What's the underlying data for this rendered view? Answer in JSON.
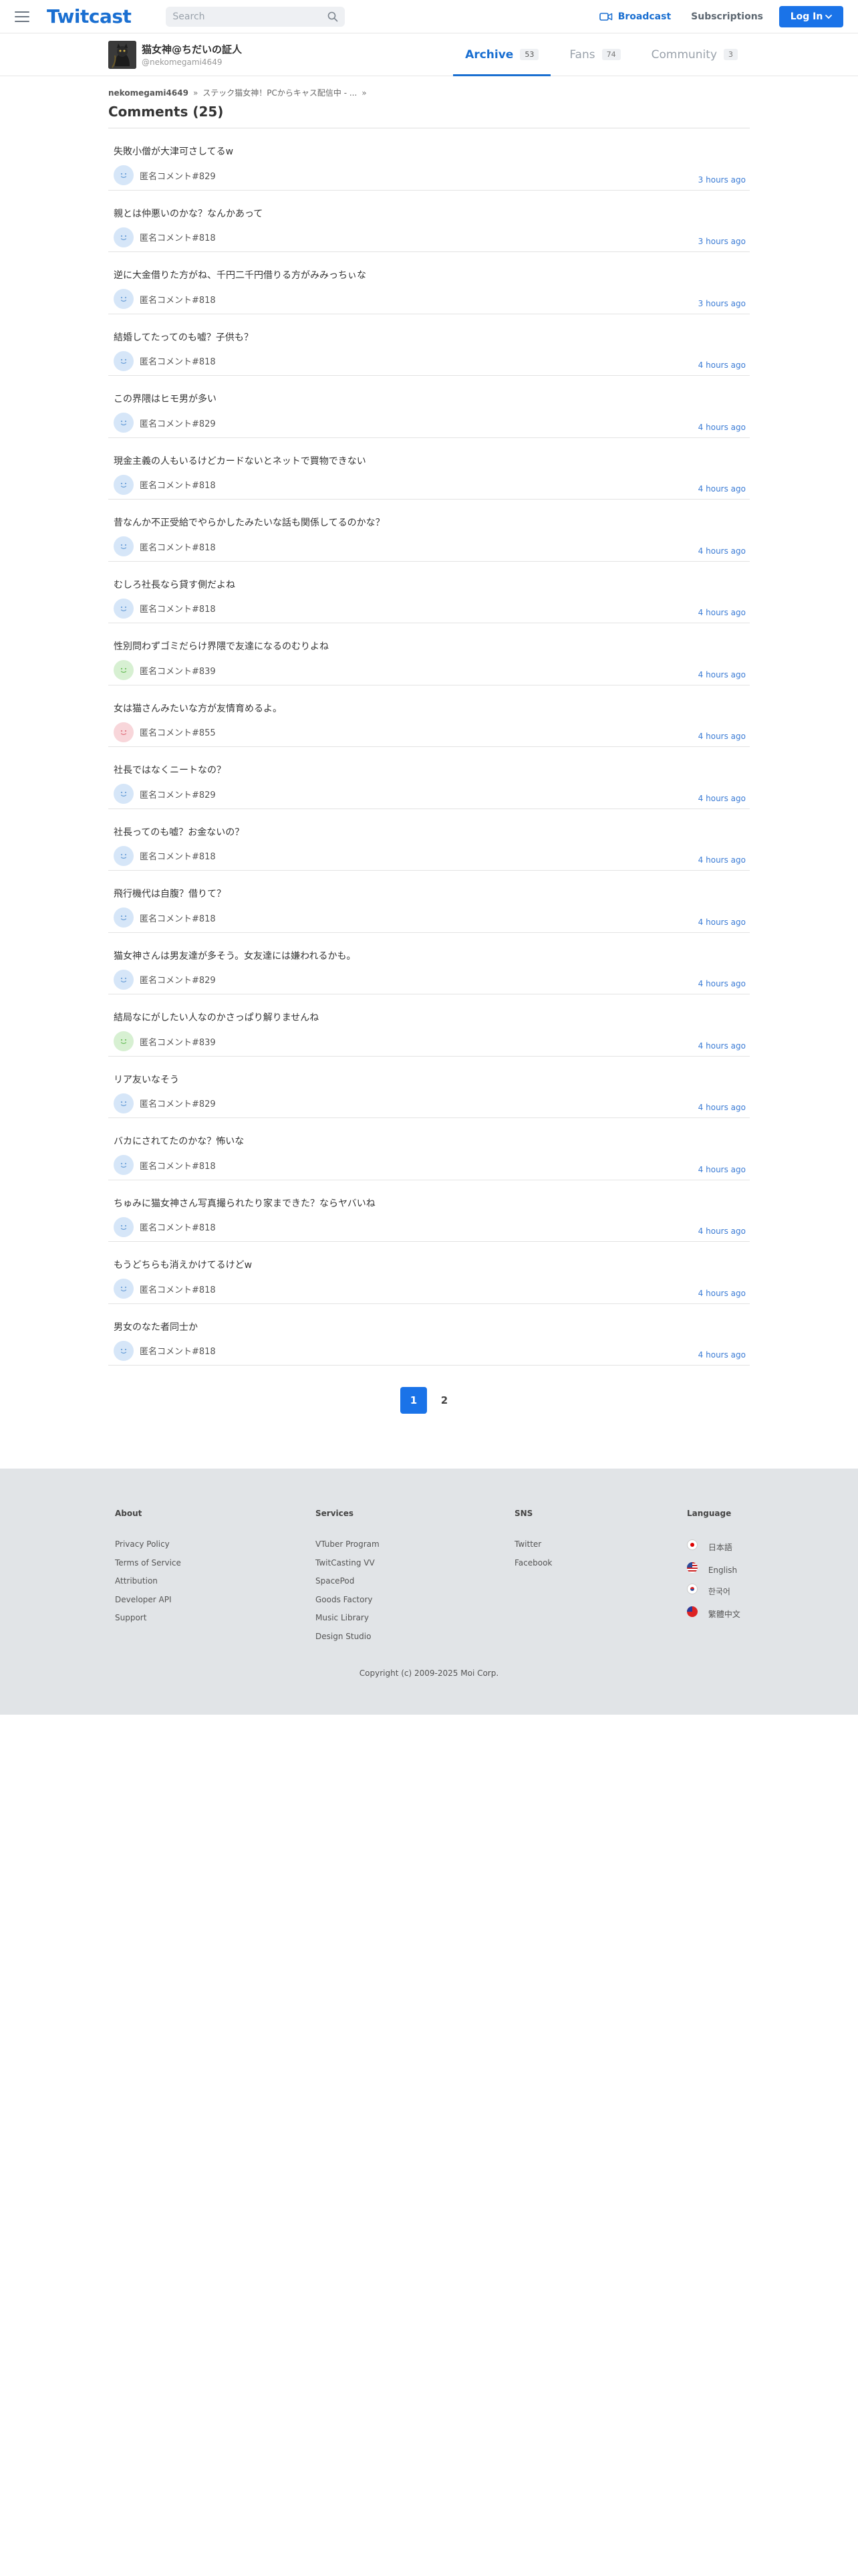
{
  "header": {
    "logo": "Twitcast",
    "search_placeholder": "Search",
    "broadcast": "Broadcast",
    "subscriptions": "Subscriptions",
    "login": "Log In"
  },
  "profile": {
    "name": "猫女神@ちだいの証人",
    "id": "@nekomegami4649"
  },
  "tabs": [
    {
      "label": "Archive",
      "count": "53"
    },
    {
      "label": "Fans",
      "count": "74"
    },
    {
      "label": "Community",
      "count": "3"
    }
  ],
  "breadcrumb": [
    "nekomegami4649",
    "ステック猫女神！PCからキャス配信中 - ...",
    ""
  ],
  "page_title": "Comments (25)",
  "comments": [
    {
      "text": "失敗小僧が大津可さしてるw",
      "name": "匿名コメント#829",
      "time": "3 hours ago",
      "avatar_color": "#d6e6f8",
      "face_color": "#6a9fd8"
    },
    {
      "text": "親とは仲悪いのかな？なんかあって",
      "name": "匿名コメント#818",
      "time": "3 hours ago",
      "avatar_color": "#d6e6f8",
      "face_color": "#6a9fd8"
    },
    {
      "text": "逆に大金借りた方がね、千円二千円借りる方がみみっちぃな",
      "name": "匿名コメント#818",
      "time": "3 hours ago",
      "avatar_color": "#d6e6f8",
      "face_color": "#6a9fd8"
    },
    {
      "text": "結婚してたってのも嘘？子供も？",
      "name": "匿名コメント#818",
      "time": "4 hours ago",
      "avatar_color": "#d6e6f8",
      "face_color": "#6a9fd8"
    },
    {
      "text": "この界隈はヒモ男が多い",
      "name": "匿名コメント#829",
      "time": "4 hours ago",
      "avatar_color": "#d6e6f8",
      "face_color": "#6a9fd8"
    },
    {
      "text": "現金主義の人もいるけどカードないとネットで買物できない",
      "name": "匿名コメント#818",
      "time": "4 hours ago",
      "avatar_color": "#d6e6f8",
      "face_color": "#6a9fd8"
    },
    {
      "text": "昔なんか不正受給でやらかしたみたいな話も関係してるのかな？",
      "name": "匿名コメント#818",
      "time": "4 hours ago",
      "avatar_color": "#d6e6f8",
      "face_color": "#6a9fd8"
    },
    {
      "text": "むしろ社長なら貸す側だよね",
      "name": "匿名コメント#818",
      "time": "4 hours ago",
      "avatar_color": "#d6e6f8",
      "face_color": "#6a9fd8"
    },
    {
      "text": "性別問わずゴミだらけ界隈で友達になるのむりよね",
      "name": "匿名コメント#839",
      "time": "4 hours ago",
      "avatar_color": "#d7f0d2",
      "face_color": "#6bbf5c"
    },
    {
      "text": "女は猫さんみたいな方が友情育めるよ。",
      "name": "匿名コメント#855",
      "time": "4 hours ago",
      "avatar_color": "#f8d6da",
      "face_color": "#e07480"
    },
    {
      "text": "社長ではなくニートなの？",
      "name": "匿名コメント#829",
      "time": "4 hours ago",
      "avatar_color": "#d6e6f8",
      "face_color": "#6a9fd8"
    },
    {
      "text": "社長ってのも嘘？お金ないの？",
      "name": "匿名コメント#818",
      "time": "4 hours ago",
      "avatar_color": "#d6e6f8",
      "face_color": "#6a9fd8"
    },
    {
      "text": "飛行機代は自腹？借りて？",
      "name": "匿名コメント#818",
      "time": "4 hours ago",
      "avatar_color": "#d6e6f8",
      "face_color": "#6a9fd8"
    },
    {
      "text": "猫女神さんは男友達が多そう。女友達には嫌われるかも。",
      "name": "匿名コメント#829",
      "time": "4 hours ago",
      "avatar_color": "#d6e6f8",
      "face_color": "#6a9fd8"
    },
    {
      "text": "結局なにがしたい人なのかさっぱり解りませんね󠄀",
      "name": "匿名コメント#839",
      "time": "4 hours ago",
      "avatar_color": "#d7f0d2",
      "face_color": "#6bbf5c"
    },
    {
      "text": "リア友いなそう",
      "name": "匿名コメント#829",
      "time": "4 hours ago",
      "avatar_color": "#d6e6f8",
      "face_color": "#6a9fd8"
    },
    {
      "text": "バカにされてたのかな？怖いな",
      "name": "匿名コメント#818",
      "time": "4 hours ago",
      "avatar_color": "#d6e6f8",
      "face_color": "#6a9fd8"
    },
    {
      "text": "ちゅみに猫女神さん写真撮られたり家まできた？ならヤバいね",
      "name": "匿名コメント#818",
      "time": "4 hours ago",
      "avatar_color": "#d6e6f8",
      "face_color": "#6a9fd8"
    },
    {
      "text": "もうどちらも消えかけてるけどw",
      "name": "匿名コメント#818",
      "time": "4 hours ago",
      "avatar_color": "#d6e6f8",
      "face_color": "#6a9fd8"
    },
    {
      "text": "男女のなた者同士か",
      "name": "匿名コメント#818",
      "time": "4 hours ago",
      "avatar_color": "#d6e6f8",
      "face_color": "#6a9fd8"
    }
  ],
  "pagination": [
    "1",
    "2"
  ],
  "footer": {
    "about": {
      "title": "About",
      "links": [
        "Privacy Policy",
        "Terms of Service",
        "Attribution",
        "Developer API",
        "Support"
      ]
    },
    "services": {
      "title": "Services",
      "links": [
        "VTuber Program",
        "TwitCasting VV",
        "SpacePod",
        "Goods Factory",
        "Music Library",
        "Design Studio"
      ]
    },
    "sns": {
      "title": "SNS",
      "links": [
        "Twitter",
        "Facebook"
      ]
    },
    "language": {
      "title": "Language",
      "links": [
        "日本語",
        "English",
        "한국어",
        "繁體中文"
      ]
    },
    "copyright": "Copyright (c) 2009-2025 Moi Corp."
  },
  "colors": {
    "accent": "#1a73e8",
    "link_time": "#3a7bd5",
    "footer_bg": "#e1e4e7"
  }
}
